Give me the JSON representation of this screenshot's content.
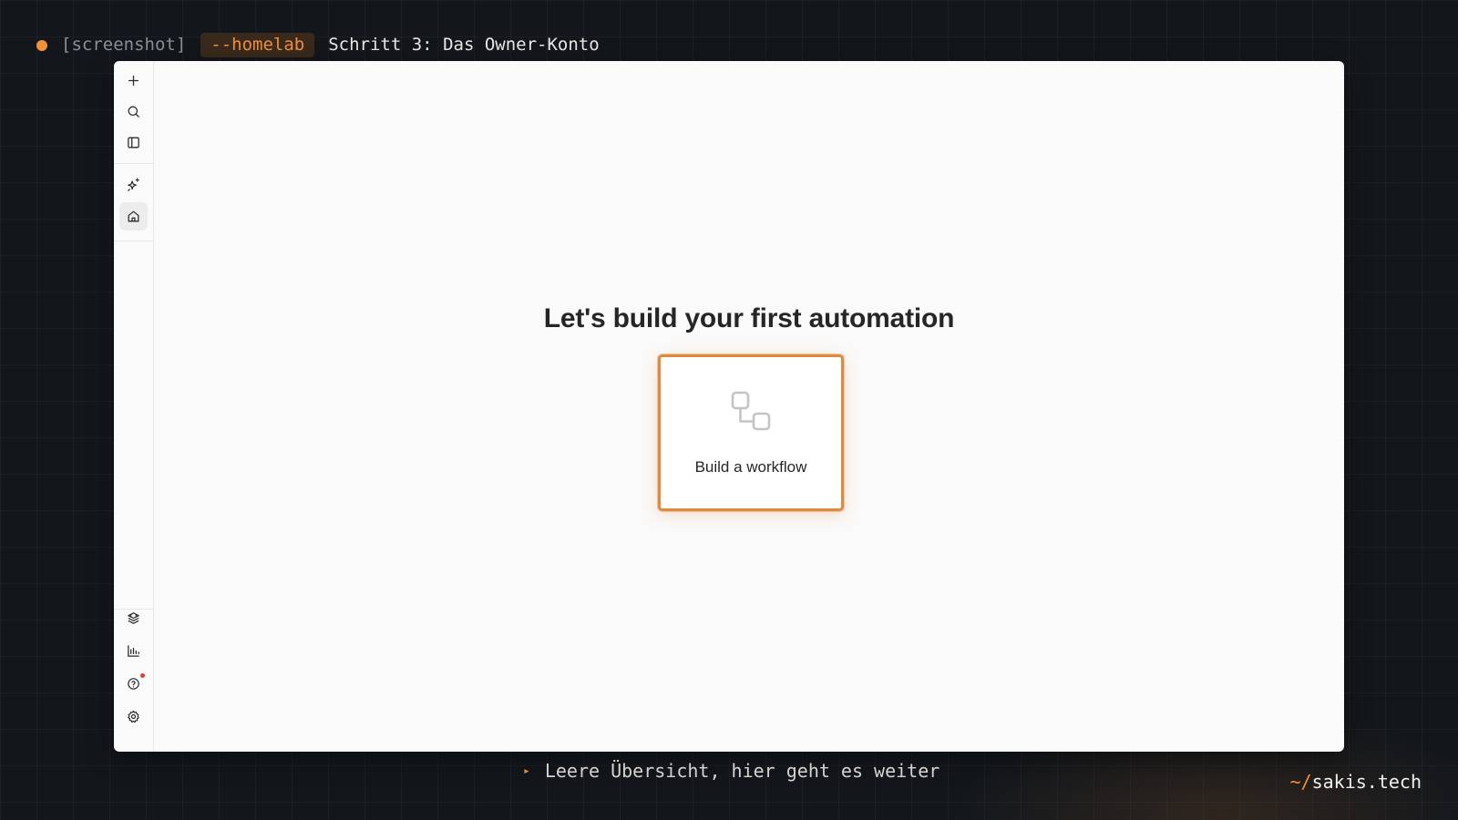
{
  "header": {
    "tag": "[screenshot]",
    "flag": "--homelab",
    "title": "Schritt 3: Das Owner-Konto"
  },
  "sidebar": {
    "top_icons": [
      "plus-icon",
      "search-icon",
      "sidebar-toggle-icon"
    ],
    "mid_icons": [
      "ai-sparkles-icon",
      "home-icon"
    ],
    "active": "home-icon",
    "bottom_icons": [
      "templates-icon",
      "insights-icon",
      "help-icon",
      "settings-icon"
    ],
    "help_has_notification": true
  },
  "main": {
    "headline": "Let's build your first automation",
    "card": {
      "label": "Build a workflow",
      "icon": "workflow-icon",
      "highlighted": true
    }
  },
  "footer": {
    "marker": "▸",
    "caption": "Leere Übersicht, hier geht es weiter",
    "brand_prefix": "~/",
    "brand_name": "sakis.tech"
  },
  "colors": {
    "accent": "#f0923a",
    "background": "#13171c",
    "window": "#fafafa",
    "notification": "#e23b3b"
  }
}
